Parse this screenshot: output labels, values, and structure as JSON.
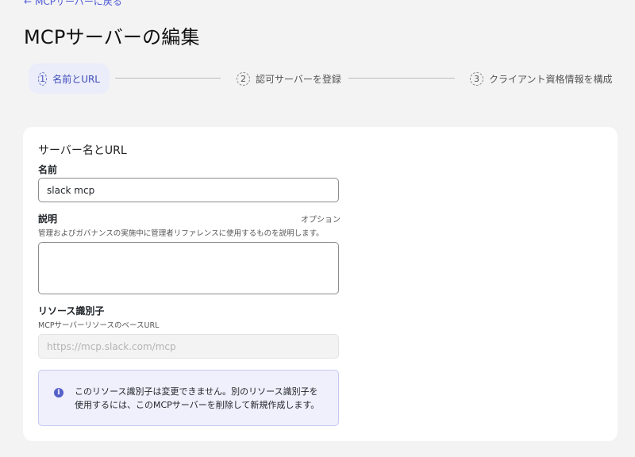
{
  "back_link": {
    "arrow": "←",
    "label": "MCPサーバーに戻る"
  },
  "page_title": "MCPサーバーの編集",
  "stepper": {
    "steps": [
      {
        "num": "1",
        "label": "名前とURL"
      },
      {
        "num": "2",
        "label": "認可サーバーを登録"
      },
      {
        "num": "3",
        "label": "クライアント資格情報を構成"
      }
    ]
  },
  "form": {
    "section_title": "サーバー名とURL",
    "name": {
      "label": "名前",
      "value": "slack mcp"
    },
    "description": {
      "label": "説明",
      "optional": "オプション",
      "help": "管理およびガバナンスの実施中に管理者リファレンスに使用するものを説明します。",
      "value": ""
    },
    "resource_id": {
      "label": "リソース識別子",
      "help": "MCPサーバーリソースのベースURL",
      "placeholder": "https://mcp.slack.com/mcp"
    },
    "info": {
      "icon": "i",
      "line1": "このリソース識別子は変更できません。別のリソース識別子を",
      "line2": "使用するには、このMCPサーバーを削除して新規作成します。"
    }
  },
  "colors": {
    "accent": "#4f5ad6",
    "info_bg": "#eff0fb",
    "page_bg": "#f3f3f4"
  }
}
